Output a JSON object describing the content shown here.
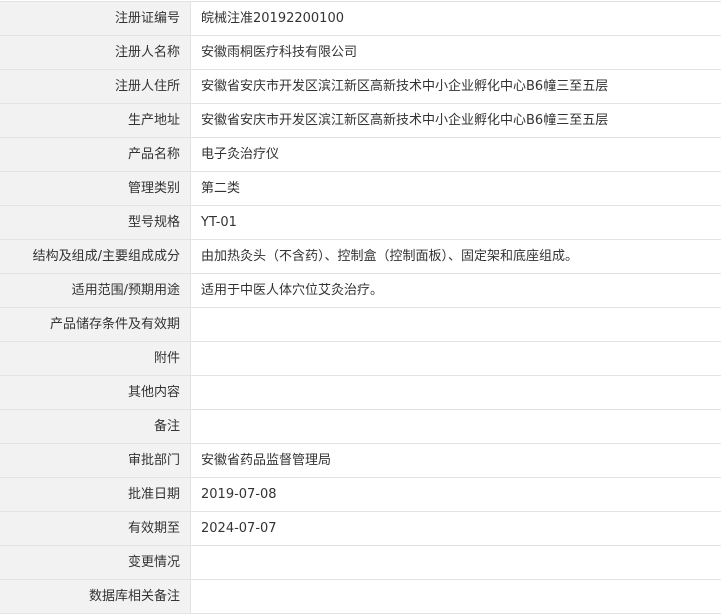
{
  "fields": [
    {
      "label": "注册证编号",
      "value": "皖械注准20192200100"
    },
    {
      "label": "注册人名称",
      "value": "安徽雨桐医疗科技有限公司"
    },
    {
      "label": "注册人住所",
      "value": "安徽省安庆市开发区滨江新区高新技术中小企业孵化中心B6幢三至五层"
    },
    {
      "label": "生产地址",
      "value": "安徽省安庆市开发区滨江新区高新技术中小企业孵化中心B6幢三至五层"
    },
    {
      "label": "产品名称",
      "value": "电子灸治疗仪"
    },
    {
      "label": "管理类别",
      "value": "第二类"
    },
    {
      "label": "型号规格",
      "value": "YT-01"
    },
    {
      "label": "结构及组成/主要组成成分",
      "value": "由加热灸头（不含药）、控制盒（控制面板）、固定架和底座组成。"
    },
    {
      "label": "适用范围/预期用途",
      "value": "适用于中医人体穴位艾灸治疗。"
    },
    {
      "label": "产品储存条件及有效期",
      "value": ""
    },
    {
      "label": "附件",
      "value": ""
    },
    {
      "label": "其他内容",
      "value": ""
    },
    {
      "label": "备注",
      "value": ""
    },
    {
      "label": "审批部门",
      "value": "安徽省药品监督管理局"
    },
    {
      "label": "批准日期",
      "value": "2019-07-08"
    },
    {
      "label": "有效期至",
      "value": "2024-07-07"
    },
    {
      "label": "变更情况",
      "value": ""
    },
    {
      "label": "数据库相关备注",
      "value": ""
    }
  ]
}
